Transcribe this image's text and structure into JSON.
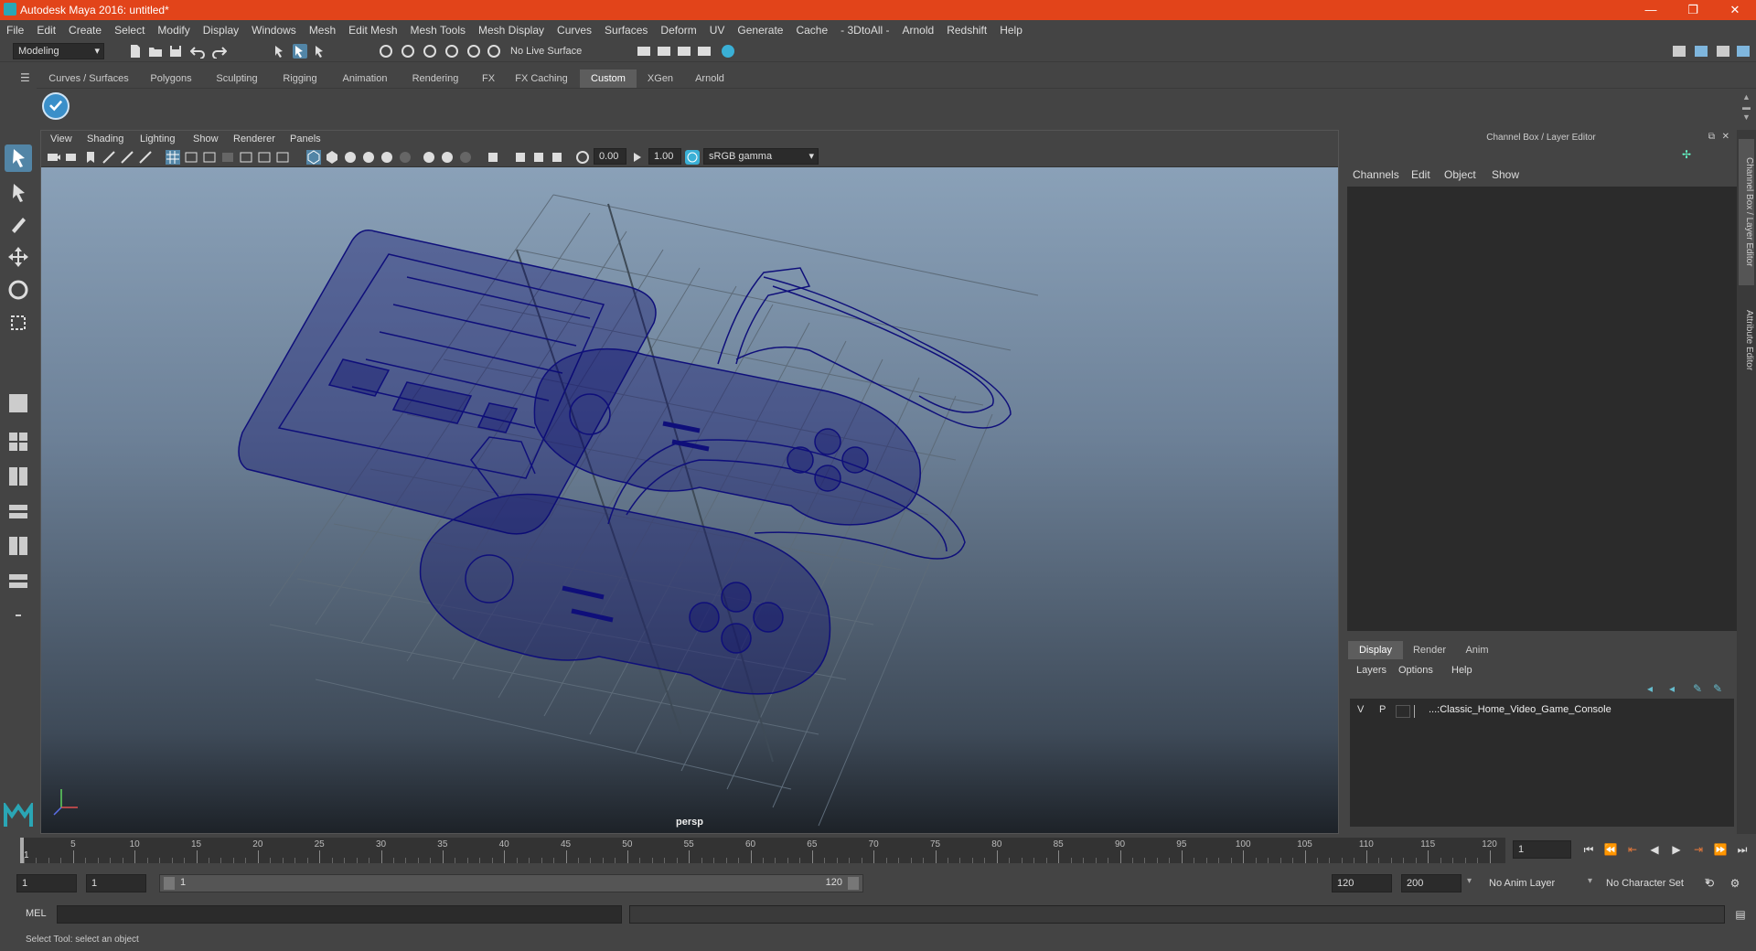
{
  "window": {
    "title": "Autodesk Maya 2016: untitled*",
    "minimize": "—",
    "restore": "❐",
    "close": "✕"
  },
  "menubar": [
    "File",
    "Edit",
    "Create",
    "Select",
    "Modify",
    "Display",
    "Windows",
    "Mesh",
    "Edit Mesh",
    "Mesh Tools",
    "Mesh Display",
    "Curves",
    "Surfaces",
    "Deform",
    "UV",
    "Generate",
    "Cache",
    "- 3DtoAll -",
    "Arnold",
    "Redshift",
    "Help"
  ],
  "statusline": {
    "mode": "Modeling",
    "live_surface": "No Live Surface"
  },
  "shelf_tabs": [
    "Curves / Surfaces",
    "Polygons",
    "Sculpting",
    "Rigging",
    "Animation",
    "Rendering",
    "FX",
    "FX Caching",
    "Custom",
    "XGen",
    "Arnold"
  ],
  "shelf_active": "Custom",
  "viewport": {
    "menu": [
      "View",
      "Shading",
      "Lighting",
      "Show",
      "Renderer",
      "Panels"
    ],
    "exposure": "0.00",
    "gamma": "1.00",
    "color_space": "sRGB gamma",
    "camera": "persp",
    "wire_color": "#0f0f7a"
  },
  "channel_box": {
    "title": "Channel Box / Layer Editor",
    "menu": [
      "Channels",
      "Edit",
      "Object",
      "Show"
    ],
    "layer_tabs": [
      "Display",
      "Render",
      "Anim"
    ],
    "layer_active": "Display",
    "layer_menu": [
      "Layers",
      "Options",
      "Help"
    ],
    "layer_row": {
      "v": "V",
      "p": "P",
      "name": "...:Classic_Home_Video_Game_Console"
    }
  },
  "side_tabs": [
    "Channel Box / Layer Editor",
    "Attribute Editor"
  ],
  "timeline": {
    "ticks": [
      "5",
      "10",
      "15",
      "20",
      "25",
      "30",
      "35",
      "40",
      "45",
      "50",
      "55",
      "60",
      "65",
      "70",
      "75",
      "80",
      "85",
      "90",
      "95",
      "100",
      "105",
      "110",
      "115",
      "120"
    ],
    "first": "1",
    "current_frame": "1"
  },
  "range": {
    "start": "1",
    "playback_start": "1",
    "slider_start": "1",
    "slider_end": "120",
    "playback_end": "120",
    "end": "200",
    "anim_layer": "No Anim Layer",
    "character_set": "No Character Set"
  },
  "cmdline": {
    "lang": "MEL"
  },
  "helpline": "Select Tool: select an object"
}
